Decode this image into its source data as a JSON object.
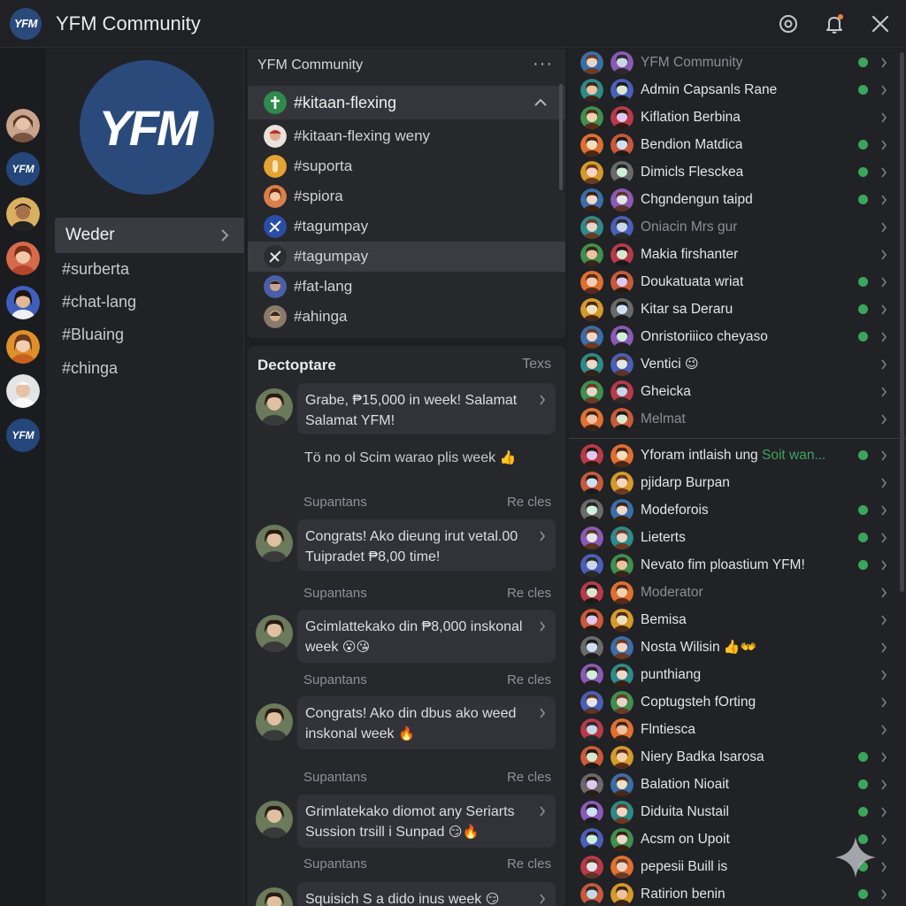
{
  "window": {
    "title": "YFM Community",
    "logo_text": "YFM",
    "icons": [
      "settings-icon",
      "bell-icon",
      "close-icon"
    ]
  },
  "rail": {
    "logo_text": "YFM"
  },
  "sidebar": {
    "server_logo_text": "YFM",
    "selected_label": "Weder",
    "channels": [
      "#surberta",
      "#chat-lang",
      "#Bluaing",
      "#chinga"
    ]
  },
  "channel_panel": {
    "header": "YFM Community",
    "more": "···",
    "active_channel": "#kitaan-flexing",
    "channels": [
      "#kitaan-flexing weny",
      "#suporta",
      "#spiora",
      "#tagumpay",
      "#tagumpay",
      "#fat-lang",
      "#ahinga"
    ]
  },
  "messages_panel": {
    "title": "Dectoptare",
    "tab": "Texs",
    "messages": [
      {
        "text": "Grabe, ₱15,000 in week! Salamat Salamat YFM!"
      },
      {
        "text": "Tö no ol Scim warao plis week",
        "emoji": "👍"
      },
      {
        "author": "Supantans",
        "action": "Re cles"
      },
      {
        "text": "Congrats! Ako dieung irut vetal.00 Tuipradet ₱8,00 time!"
      },
      {
        "author": "Supantans",
        "action": "Re cles"
      },
      {
        "text": "Gcimlattekako din ₱8,000 inskonal week",
        "emoji": "😮😘"
      },
      {
        "author": "Supantans",
        "action": "Re cles"
      },
      {
        "text": "Congrats! Ako din dbus ako weed inskonal week",
        "emoji": "🔥"
      },
      {
        "author": "Supantans",
        "action": "Re cles"
      },
      {
        "text": "Grimlatekako diomot any Seriarts Sussion trsill i Sunpad",
        "emoji": "😏🔥"
      },
      {
        "author": "Supantans",
        "action": "Re cles"
      },
      {
        "text": "Squisich S a dido inus week",
        "emoji": "😏"
      }
    ]
  },
  "members_top": [
    {
      "name": "YFM Community",
      "dim": true,
      "online": true
    },
    {
      "name": "Admin Capsanls Rane",
      "online": true
    },
    {
      "name": "Kiflation Berbina",
      "online": false
    },
    {
      "name": "Bendion Matdica",
      "online": true
    },
    {
      "name": "Dimicls Flesckea",
      "online": true
    },
    {
      "name": "Chgndengun taipd",
      "online": true
    },
    {
      "name": "Oniacin Mrs gur",
      "dim": true,
      "online": false
    },
    {
      "name": "Makia firshanter",
      "online": false
    },
    {
      "name": "Doukatuata wriat",
      "online": true
    },
    {
      "name": "Kitar sa Deraru",
      "online": true
    },
    {
      "name": "Onristoriiico cheyaso",
      "online": true
    },
    {
      "name": "Ventici",
      "emoji": "😉",
      "online": false
    },
    {
      "name": "Gheicka",
      "online": false
    },
    {
      "name": "Melmat",
      "dim": true,
      "online": false
    }
  ],
  "members_bottom": [
    {
      "name": "Yforam intlaish ung",
      "extra": "Soit wan...",
      "online": true
    },
    {
      "name": "pjidarp Burpan",
      "online": false
    },
    {
      "name": "Modeforois",
      "online": true
    },
    {
      "name": "Lieterts",
      "online": true
    },
    {
      "name": "Nevato fim ploastium YFM!",
      "online": true
    },
    {
      "name": "Moderator",
      "dim": true,
      "online": false
    },
    {
      "name": "Bemisa",
      "online": false
    },
    {
      "name": "Nosta Wilisin",
      "emoji": "👍👐",
      "online": false
    },
    {
      "name": "punthiang",
      "online": false
    },
    {
      "name": "Coptugsteh fOrting",
      "online": false
    },
    {
      "name": "Flntiesca",
      "online": false
    },
    {
      "name": "Niery Badka Isarosa",
      "online": true
    },
    {
      "name": "Balation Nioait",
      "online": true
    },
    {
      "name": "Diduita Nustail",
      "online": true
    },
    {
      "name": "Acsm on Upoit",
      "online": true
    },
    {
      "name": "pepesii Buill is",
      "online": true
    },
    {
      "name": "Ratirion benin",
      "online": true
    }
  ],
  "colors": {
    "online": "#3ba55c",
    "accent_logo": "#2b4a7c",
    "bell_badge": "#e8833a",
    "highlight_text": "#3ba55c"
  }
}
